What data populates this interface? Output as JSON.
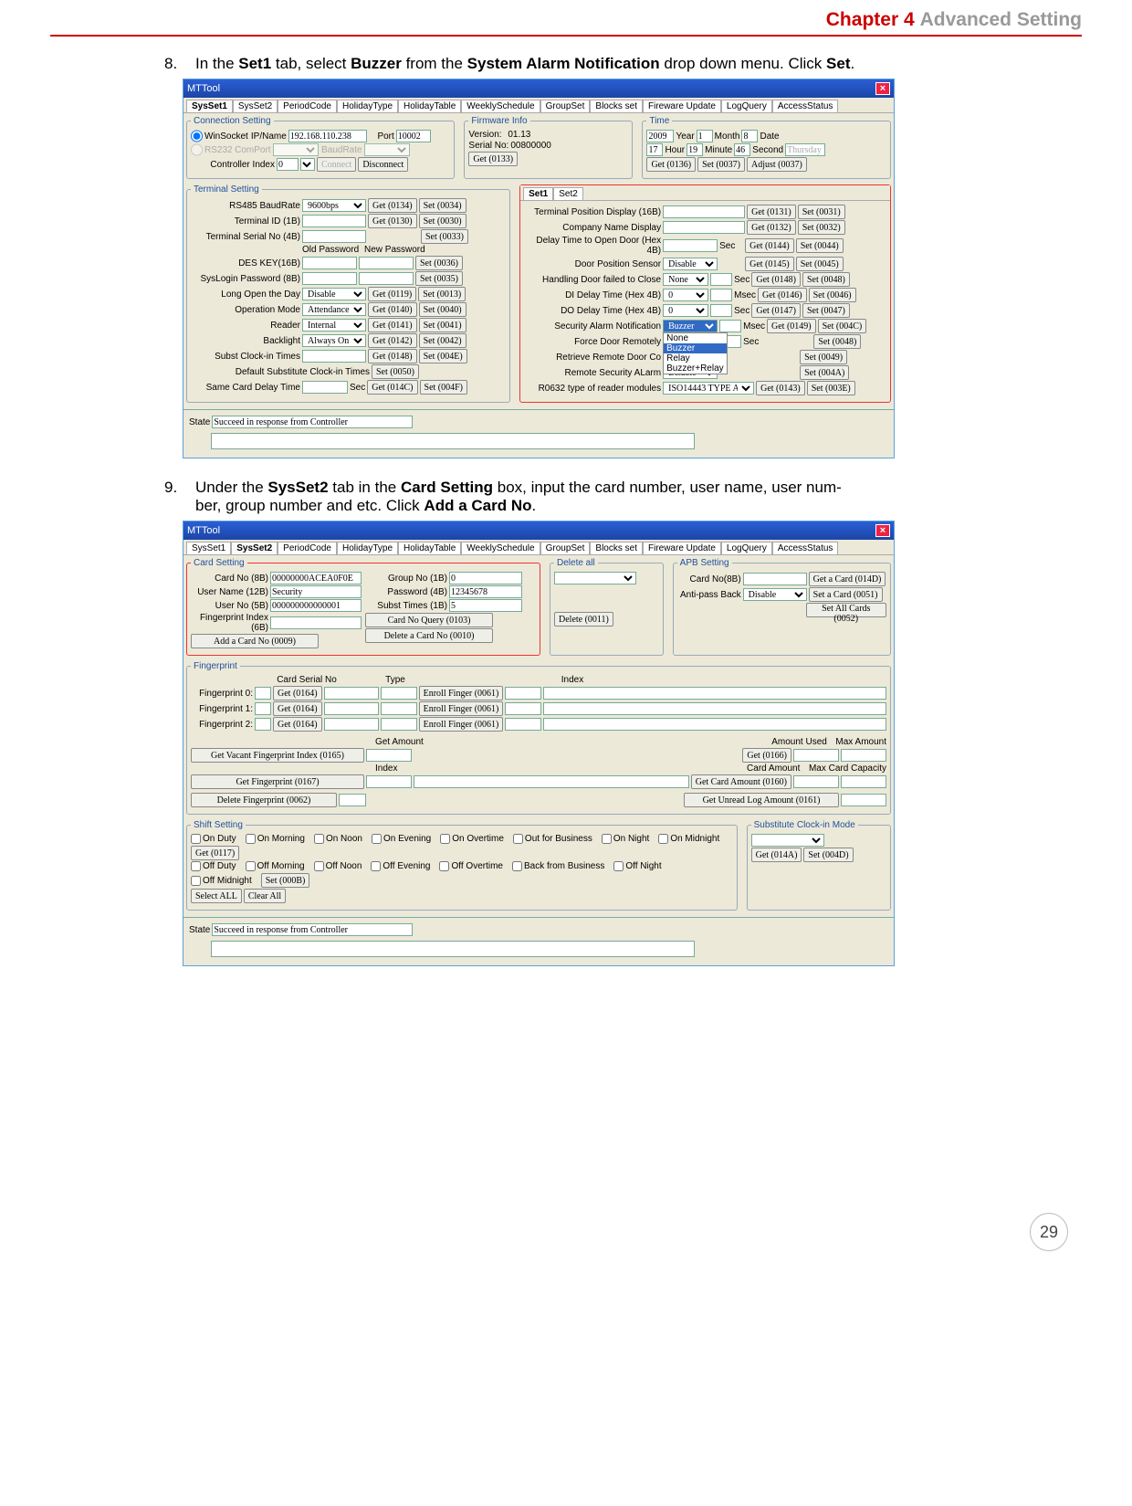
{
  "header": {
    "chapter": "Chapter 4",
    "title": "Advanced Setting"
  },
  "step8": {
    "num": "8.",
    "prefix": "In the ",
    "b1": "Set1",
    "mid1": " tab, select ",
    "b2": "Buzzer",
    "mid2": " from the ",
    "b3": "System Alarm Notification",
    "mid3": " drop down menu. Click ",
    "b4": "Set",
    "suffix": "."
  },
  "step9": {
    "num": "9.",
    "prefix": "Under the ",
    "b1": "SysSet2",
    "mid1": " tab in the ",
    "b2": "Card Setting",
    "mid2": " box, input the card number, user name, user num-",
    "line2_prefix": "ber, group number and etc. Click ",
    "b3": "Add a Card No",
    "suffix": "."
  },
  "win1": {
    "title": "MTTool",
    "tabs": [
      "SysSet1",
      "SysSet2",
      "PeriodCode",
      "HolidayType",
      "HolidayTable",
      "WeeklySchedule",
      "GroupSet",
      "Blocks set",
      "Fireware Update",
      "LogQuery",
      "AccessStatus"
    ],
    "tab_sel": 0,
    "conn": {
      "legend": "Connection Setting",
      "winsocket": "WinSocket",
      "rs232": "RS232",
      "ipname": "IP/Name",
      "ip_val": "192.168.110.238",
      "port": "Port",
      "port_val": "10002",
      "comport": "ComPort",
      "baud": "BaudRate",
      "ctlidx": "Controller Index",
      "ctlidx_val": "0",
      "connect": "Connect",
      "disconnect": "Disconnect"
    },
    "fw": {
      "legend": "Firmware Info",
      "ver_lbl": "Version:",
      "ver": "01.13",
      "ser_lbl": "Serial No:",
      "ser": "00800000",
      "get": "Get (0133)"
    },
    "time": {
      "legend": "Time",
      "year": "2009",
      "year_lbl": "Year",
      "month": "1",
      "month_lbl": "Month",
      "date": "8",
      "date_lbl": "Date",
      "hour": "17",
      "hour_lbl": "Hour",
      "min": "19",
      "min_lbl": "Minute",
      "sec": "46",
      "sec_lbl": "Second",
      "day": "Thursday",
      "get": "Get (0136)",
      "set": "Set (0037)",
      "adj": "Adjust (0037)"
    },
    "term": {
      "legend": "Terminal Setting",
      "rows": [
        {
          "l": "RS485 BaudRate",
          "v": "9600bps",
          "sel": true,
          "g": "Get (0134)",
          "s": "Set (0034)"
        },
        {
          "l": "Terminal ID (1B)",
          "v": "",
          "g": "Get (0130)",
          "s": "Set (0030)"
        },
        {
          "l": "Terminal Serial No (4B)",
          "v": "",
          "s": "Set (0033)"
        }
      ],
      "pw_old": "Old Password",
      "pw_new": "New Password",
      "des": "DES KEY(16B)",
      "des_set": "Set (0036)",
      "sys": "SysLogin Password (8B)",
      "sys_set": "Set (0035)",
      "lod": "Long Open the Day",
      "lod_v": "Disable",
      "lod_g": "Get (0119)",
      "lod_s": "Set (0013)",
      "opm": "Operation Mode",
      "opm_v": "Attendance",
      "opm_g": "Get (0140)",
      "opm_s": "Set (0040)",
      "rdr": "Reader",
      "rdr_v": "Internal",
      "rdr_g": "Get (0141)",
      "rdr_s": "Set (0041)",
      "bkl": "Backlight",
      "bkl_v": "Always On",
      "bkl_g": "Get (0142)",
      "bkl_s": "Set (0042)",
      "sub": "Subst Clock-in Times",
      "sub_g": "Get (0148)",
      "sub_s": "Set (004E)",
      "def": "Default Substitute Clock-in Times",
      "def_s": "Set (0050)",
      "scd": "Same Card Delay Time",
      "scd_u": "Sec",
      "scd_g": "Get (014C)",
      "scd_s": "Set (004F)"
    },
    "right": {
      "tabs": [
        "Set1",
        "Set2"
      ],
      "tab_sel": 0,
      "tp": "Terminal Position Display (16B)",
      "tp_g": "Get (0131)",
      "tp_s": "Set (0031)",
      "cn": "Company Name Display",
      "cn_g": "Get (0132)",
      "cn_s": "Set (0032)",
      "dt": "Delay Time to Open Door (Hex 4B)",
      "dt_u": "Sec",
      "dt_g": "Get (0144)",
      "dt_s": "Set (0044)",
      "dp": "Door Position Sensor",
      "dp_v": "Disable",
      "dp_g": "Get (0145)",
      "dp_s": "Set (0045)",
      "hd": "Handling Door failed to Close",
      "hd_v": "None",
      "hd_u": "Sec",
      "hd_g": "Get (0148)",
      "hd_s": "Set (0048)",
      "di": "DI Delay Time (Hex 4B)",
      "di_v": "0",
      "di_u": "Msec",
      "di_g": "Get (0146)",
      "di_s": "Set (0046)",
      "do": "DO Delay Time (Hex 4B)",
      "do_v": "0",
      "do_u": "Sec",
      "do_g": "Get (0147)",
      "do_s": "Set (0047)",
      "sa": "Security Alarm Notification",
      "sa_v": "Buzzer",
      "sa_u": "Msec",
      "sa_g": "Get (0149)",
      "sa_s": "Set (004C)",
      "sa_opts": [
        "None",
        "Buzzer",
        "Relay",
        "Buzzer+Relay"
      ],
      "fd": "Force Door Remotely",
      "fd_u": "Sec",
      "fd_s": "Set (0048)",
      "rr": "Retrieve Remote Door Co",
      "rr_s": "Set (0049)",
      "rs": "Remote Security ALarm",
      "rs_v": "Disable",
      "rs_s": "Set (004A)",
      "r6": "R0632 type of reader modules",
      "r6_v": "ISO14443 TYPE A",
      "r6_g": "Get (0143)",
      "r6_s": "Set (003E)"
    },
    "state_lbl": "State",
    "state_val": "Succeed in response from Controller"
  },
  "win2": {
    "title": "MTTool",
    "tabs": [
      "SysSet1",
      "SysSet2",
      "PeriodCode",
      "HolidayType",
      "HolidayTable",
      "WeeklySchedule",
      "GroupSet",
      "Blocks set",
      "Fireware Update",
      "LogQuery",
      "AccessStatus"
    ],
    "tab_sel": 1,
    "card": {
      "legend": "Card Setting",
      "cno": "Card No (8B)",
      "cno_v": "00000000ACEA0F0E",
      "unm": "User Name (12B)",
      "unm_v": "Security",
      "uno": "User No (5B)",
      "uno_v": "000000000000001",
      "fpi": "Fingerprint Index (6B)",
      "grp": "Group No (1B)",
      "grp_v": "0",
      "pwd": "Password (4B)",
      "pwd_v": "12345678",
      "sub": "Subst Times (1B)",
      "sub_v": "5",
      "cnq": "Card No Query (0103)",
      "add": "Add a Card No (0009)",
      "del": "Delete a Card No (0010)"
    },
    "delall": {
      "legend": "Delete all",
      "btn": "Delete (0011)"
    },
    "apb": {
      "legend": "APB Setting",
      "cno": "Card No(8B)",
      "gc": "Get a Card (014D)",
      "ap": "Anti-pass Back",
      "ap_v": "Disable",
      "sc": "Set a Card (0051)",
      "sac": "Set All Cards (0052)"
    },
    "fp": {
      "legend": "Fingerprint",
      "h_csn": "Card Serial No",
      "h_type": "Type",
      "h_idx": "Index",
      "r": [
        {
          "l": "Fingerprint 0:",
          "g": "Get (0164)",
          "e": "Enroll Finger (0061)"
        },
        {
          "l": "Fingerprint 1:",
          "g": "Get (0164)",
          "e": "Enroll Finger (0061)"
        },
        {
          "l": "Fingerprint 2:",
          "g": "Get (0164)",
          "e": "Enroll Finger (0061)"
        }
      ],
      "ga": "Get Amount",
      "au": "Amount Used",
      "ma": "Max Amount",
      "gvfi": "Get Vacant Fingerprint Index (0165)",
      "g0166": "Get (0166)",
      "idx": "Index",
      "ca": "Card Amount",
      "mcc": "Max Card Capacity",
      "gf": "Get Fingerprint (0167)",
      "gca": "Get Card Amount (0160)",
      "df": "Delete Fingerprint (0062)",
      "gula": "Get Unread Log Amount (0161)"
    },
    "shift": {
      "legend": "Shift Setting",
      "row1": [
        "On Duty",
        "On Morning",
        "On Noon",
        "On Evening",
        "On Overtime",
        "Out for Business",
        "On Night",
        "On Midnight"
      ],
      "g1": "Get (0117)",
      "row2": [
        "Off Duty",
        "Off Morning",
        "Off Noon",
        "Off Evening",
        "Off Overtime",
        "Back from Business",
        "Off Night",
        "Off Midnight"
      ],
      "s1": "Set (000B)",
      "sel_all": "Select ALL",
      "clr_all": "Clear All"
    },
    "subci": {
      "legend": "Substitute Clock-in Mode",
      "g": "Get (014A)",
      "s": "Set (004D)"
    },
    "state_lbl": "State",
    "state_val": "Succeed in response from Controller"
  },
  "page_no": "29"
}
